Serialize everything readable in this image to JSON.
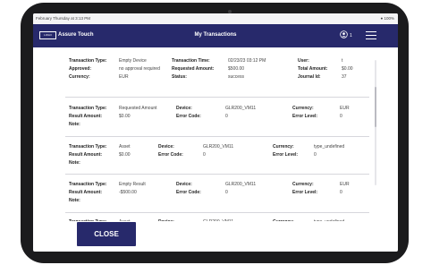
{
  "status_bar": {
    "left": "February Thursday at 3:13 PM",
    "right": "100%"
  },
  "app_bar": {
    "brand": "Assure Touch",
    "logo_text": "LOGO",
    "title": "My Transactions",
    "notification_count": "1"
  },
  "icons": {
    "user": "user-circle-icon",
    "menu": "hamburger-menu-icon",
    "wifi": "wifi-icon",
    "battery": "battery-icon"
  },
  "cards": [
    {
      "rows": [
        {
          "a": {
            "l": "Transaction Type:",
            "v": "Empty Device"
          },
          "b": {
            "l": "Transaction Time:",
            "v": "02/23/23 03:12 PM"
          },
          "c": {
            "l": "User:",
            "v": "t"
          }
        },
        {
          "a": {
            "l": "Approved:",
            "v": "no approval required"
          },
          "b": {
            "l": "Requested Amount:",
            "v": "$500.00"
          },
          "c": {
            "l": "Total Amount:",
            "v": "$0.00"
          }
        },
        {
          "a": {
            "l": "Currency:",
            "v": "EUR"
          },
          "b": {
            "l": "Status:",
            "v": "success"
          },
          "c": {
            "l": "Journal Id:",
            "v": "37"
          }
        }
      ]
    },
    {
      "rows": [
        {
          "a": {
            "l": "Transaction Type:",
            "v": "Requested Amount"
          },
          "b": {
            "l": "Device:",
            "v": "GLR200_VM11"
          },
          "c": {
            "l": "Currency:",
            "v": "EUR"
          }
        },
        {
          "a": {
            "l": "Result Amount:",
            "v": "$0.00"
          },
          "b": {
            "l": "Error Code:",
            "v": "0"
          },
          "c": {
            "l": "Error Level:",
            "v": "0"
          }
        },
        {
          "a": {
            "l": "Note:",
            "v": ""
          }
        }
      ]
    },
    {
      "rows": [
        {
          "a": {
            "l": "Transaction Type:",
            "v": "Asset"
          },
          "b": {
            "l": "Device:",
            "v": "GLR200_VM11"
          },
          "c": {
            "l": "Currency:",
            "v": "type_undefined"
          }
        },
        {
          "a": {
            "l": "Result Amount:",
            "v": "$0.00"
          },
          "b": {
            "l": "Error Code:",
            "v": "0"
          },
          "c": {
            "l": "Error Level:",
            "v": "0"
          }
        },
        {
          "a": {
            "l": "Note:",
            "v": ""
          }
        }
      ]
    },
    {
      "rows": [
        {
          "a": {
            "l": "Transaction Type:",
            "v": "Empty Result"
          },
          "b": {
            "l": "Device:",
            "v": "GLR200_VM11"
          },
          "c": {
            "l": "Currency:",
            "v": "EUR"
          }
        },
        {
          "a": {
            "l": "Result Amount:",
            "v": "-$500.00"
          },
          "b": {
            "l": "Error Code:",
            "v": "0"
          },
          "c": {
            "l": "Error Level:",
            "v": "0"
          }
        },
        {
          "a": {
            "l": "Note:",
            "v": ""
          }
        }
      ]
    },
    {
      "rows": [
        {
          "a": {
            "l": "Transaction Type:",
            "v": "Asset"
          },
          "b": {
            "l": "Device:",
            "v": "GLR200_VM11"
          },
          "c": {
            "l": "Currency:",
            "v": "type_undefined"
          }
        }
      ]
    }
  ],
  "buttons": {
    "close": "CLOSE"
  },
  "colors": {
    "primary": "#27296b",
    "bezel": "#1b1b1d"
  }
}
